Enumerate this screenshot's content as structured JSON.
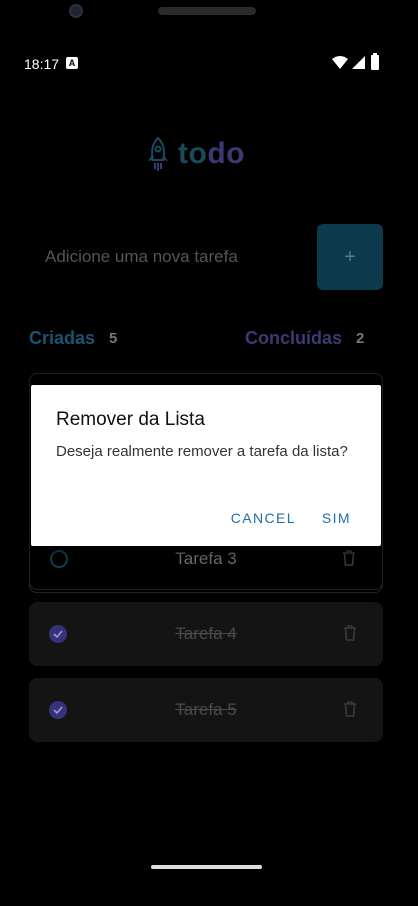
{
  "status_bar": {
    "time": "18:17",
    "notification_icon_letter": "A"
  },
  "app": {
    "logo_to": "to",
    "logo_do": "do",
    "task_input": {
      "placeholder": "Adicione uma nova tarefa"
    },
    "add_button_label": "+",
    "counters": {
      "created_label": "Criadas",
      "created_count": "5",
      "done_label": "Concluídas",
      "done_count": "2"
    },
    "tasks": [
      {
        "title": "Tarefa 3",
        "completed": false
      },
      {
        "title": "Tarefa 4",
        "completed": true
      },
      {
        "title": "Tarefa 5",
        "completed": true
      }
    ]
  },
  "dialog": {
    "title": "Remover da Lista",
    "message": "Deseja realmente remover a tarefa da lista?",
    "cancel_label": "CANCEL",
    "confirm_label": "SIM"
  },
  "colors": {
    "background": "#000000",
    "accent_blue": "#1f6fa8",
    "accent_purple": "#3c3a72"
  }
}
